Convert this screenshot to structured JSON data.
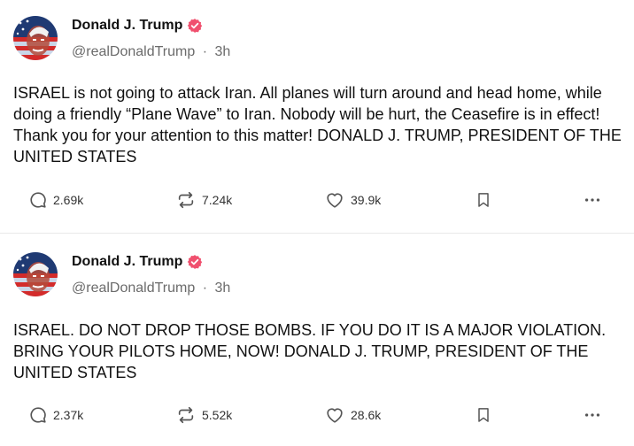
{
  "posts": [
    {
      "author": {
        "name": "Donald J. Trump",
        "handle": "@realDonaldTrump",
        "time": "3h"
      },
      "text": "ISRAEL is not going to attack Iran. All planes will turn around and head home, while doing a friendly “Plane Wave” to Iran. Nobody will be hurt, the Ceasefire is in effect! Thank you for your attention to this matter! DONALD J. TRUMP, PRESIDENT OF THE UNITED STATES",
      "stats": {
        "replies": "2.69k",
        "retruths": "7.24k",
        "likes": "39.9k"
      }
    },
    {
      "author": {
        "name": "Donald J. Trump",
        "handle": "@realDonaldTrump",
        "time": "3h"
      },
      "text": "ISRAEL. DO NOT DROP THOSE BOMBS. IF YOU DO IT IS A MAJOR VIOLATION. BRING YOUR PILOTS HOME, NOW!  DONALD J. TRUMP, PRESIDENT OF THE UNITED STATES",
      "stats": {
        "replies": "2.37k",
        "retruths": "5.52k",
        "likes": "28.6k"
      }
    }
  ],
  "separator": "·",
  "icons": {
    "verified": "verified-badge-icon",
    "reply": "reply-bubble-icon",
    "retruth": "retruth-arrows-icon",
    "like": "heart-icon",
    "save": "bookmark-icon",
    "more": "more-dots-icon"
  },
  "colors": {
    "verified": "#f0506e",
    "icon": "#555555",
    "muted": "#6b6b6b",
    "text": "#111111"
  }
}
